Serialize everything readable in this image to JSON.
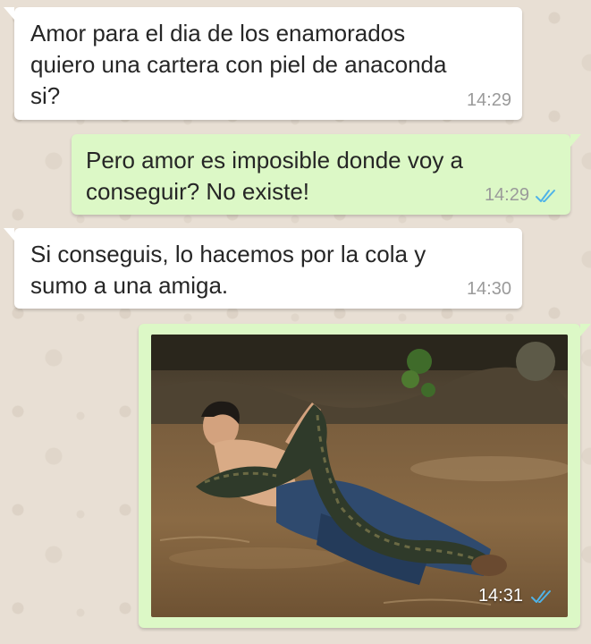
{
  "chat": {
    "messages": [
      {
        "direction": "incoming",
        "text": "Amor para el dia de los enamorados\nquiero una cartera con piel de anaconda\nsi?",
        "time": "14:29"
      },
      {
        "direction": "outgoing",
        "text": "Pero amor es imposible donde voy a\nconseguir? No existe!",
        "time": "14:29",
        "status_icon": "double-check-read-icon"
      },
      {
        "direction": "incoming",
        "text": "Si conseguis, lo hacemos por la cola y\nsumo a una amiga.",
        "time": "14:30"
      },
      {
        "direction": "outgoing",
        "type": "image",
        "image_description_icon": "photo-man-with-anaconda-in-river",
        "time": "14:31",
        "status_icon": "double-check-read-icon"
      }
    ]
  },
  "colors": {
    "wallpaper": "#e8dfd4",
    "incoming_bubble": "#ffffff",
    "outgoing_bubble": "#dcf8c6",
    "read_ticks": "#4fb3e8",
    "timestamp": "#9a9a9a"
  }
}
